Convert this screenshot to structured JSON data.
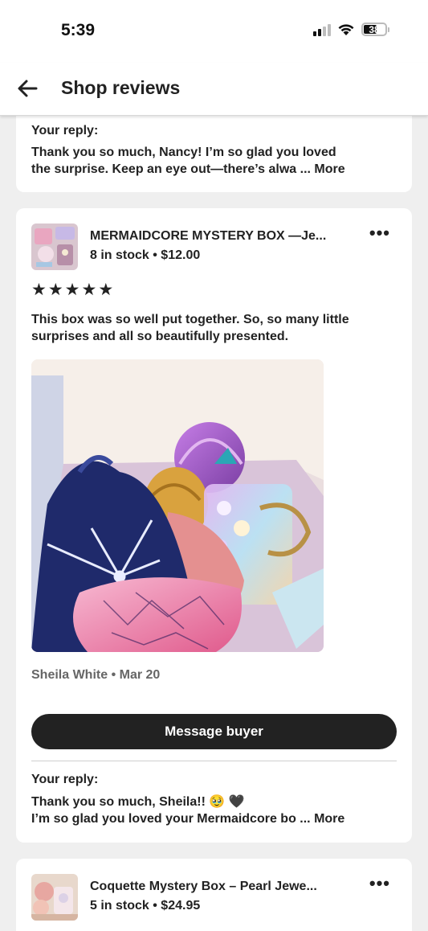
{
  "status_bar": {
    "time": "5:39",
    "battery": "38"
  },
  "header": {
    "title": "Shop reviews"
  },
  "top_card": {
    "reply_label": "Your reply:",
    "reply_text_1": "Thank you so much, Nancy! I’m so glad you loved",
    "reply_text_2": "the surprise. Keep an eye out—there’s alwa ...",
    "more": "More"
  },
  "review_card": {
    "product_title": "MERMAIDCORE MYSTERY BOX —Je...",
    "product_meta": "8 in stock • $12.00",
    "rating": 5,
    "stars": "★★★★★",
    "review_text": "This box was so well put together.  So, so many little surprises and all so beautifully presented.",
    "reviewer": "Sheila White • Mar 20",
    "message_button": "Message buyer",
    "reply_label": "Your reply:",
    "reply_text_1": "Thank you so much, Sheila!! 🥹 🖤",
    "reply_text_2": "I’m so glad you loved your Mermaidcore bo ...",
    "more": "More"
  },
  "next_card": {
    "product_title": "Coquette Mystery Box – Pearl Jewe...",
    "product_meta": "5 in stock • $24.95"
  },
  "icons": [
    "back-arrow-icon",
    "more-options-icon",
    "star-icon",
    "signal-icon",
    "wifi-icon",
    "battery-icon"
  ],
  "colors": {
    "button_bg": "#222222",
    "page_bg": "#efefef",
    "card_bg": "#ffffff",
    "muted_text": "#666666"
  }
}
